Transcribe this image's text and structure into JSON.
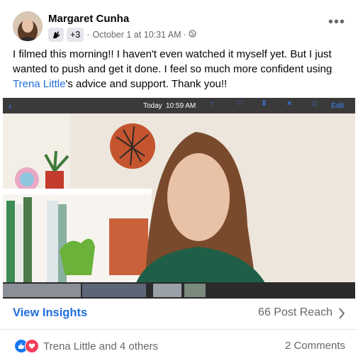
{
  "post": {
    "author": "Margaret Cunha",
    "group_count": "+3",
    "date": "October 1 at 10:31 AM",
    "separator": "·",
    "body_before_link": "I filmed this morning!! I haven't even watched it myself yet. But I just wanted to push and get it done. I feel so much more confident using ",
    "mention": "Trena Little",
    "body_after_link": "'s advice and support. Thank you!!"
  },
  "video": {
    "day_label": "Today",
    "time": "10:59 AM",
    "edit_label": "Edit"
  },
  "insights": {
    "label": "View Insights",
    "reach": "66 Post Reach"
  },
  "footer": {
    "reactions_text": "Trena Little and 4 others",
    "comments": "2 Comments"
  },
  "colors": {
    "link": "#216fdb",
    "muted": "#65676b",
    "like": "#1877f2",
    "love": "#f33e58"
  }
}
